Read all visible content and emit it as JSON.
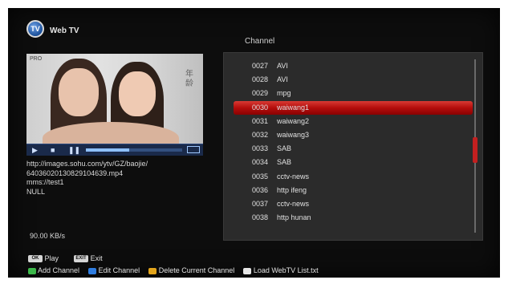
{
  "header": {
    "logo": "TV",
    "title": "Web TV"
  },
  "channel_heading": "Channel",
  "preview": {
    "corner_logo": "PRO",
    "side_text": "年龄",
    "controls": {
      "play_icon": "▶",
      "stop_icon": "■",
      "pause_icon": "❚❚",
      "progress": 0.45
    }
  },
  "info": {
    "url_line1": "http://images.sohu.com/ytv/GZ/baojie/",
    "url_line2": "640360201308291046​39.mp4",
    "line3": "mms://test1",
    "line4": "NULL"
  },
  "speed": "90.00 KB/s",
  "channels": [
    {
      "num": "0027",
      "name": "AVI"
    },
    {
      "num": "0028",
      "name": "AVI"
    },
    {
      "num": "0029",
      "name": "mpg"
    },
    {
      "num": "0030",
      "name": "waiwang1"
    },
    {
      "num": "0031",
      "name": "waiwang2"
    },
    {
      "num": "0032",
      "name": "waiwang3"
    },
    {
      "num": "0033",
      "name": "SAB"
    },
    {
      "num": "0034",
      "name": "SAB"
    },
    {
      "num": "0035",
      "name": "cctv-news"
    },
    {
      "num": "0036",
      "name": "http ifeng"
    },
    {
      "num": "0037",
      "name": "cctv-news"
    },
    {
      "num": "0038",
      "name": "http hunan"
    }
  ],
  "selected_channel": "0030",
  "footer": {
    "ok_key": "OK",
    "ok_label": "Play",
    "exit_key": "EXIT",
    "exit_label": "Exit",
    "green_label": "Add Channel",
    "blue_label": "Edit Channel",
    "yellow_label": "Delete Current Channel",
    "white_label": "Load WebTV List.txt"
  },
  "colors": {
    "selection": "#b40d0b",
    "green": "#3cb84a",
    "blue": "#2f7de0",
    "yellow": "#e3a51c",
    "white": "#e6e6e6"
  }
}
